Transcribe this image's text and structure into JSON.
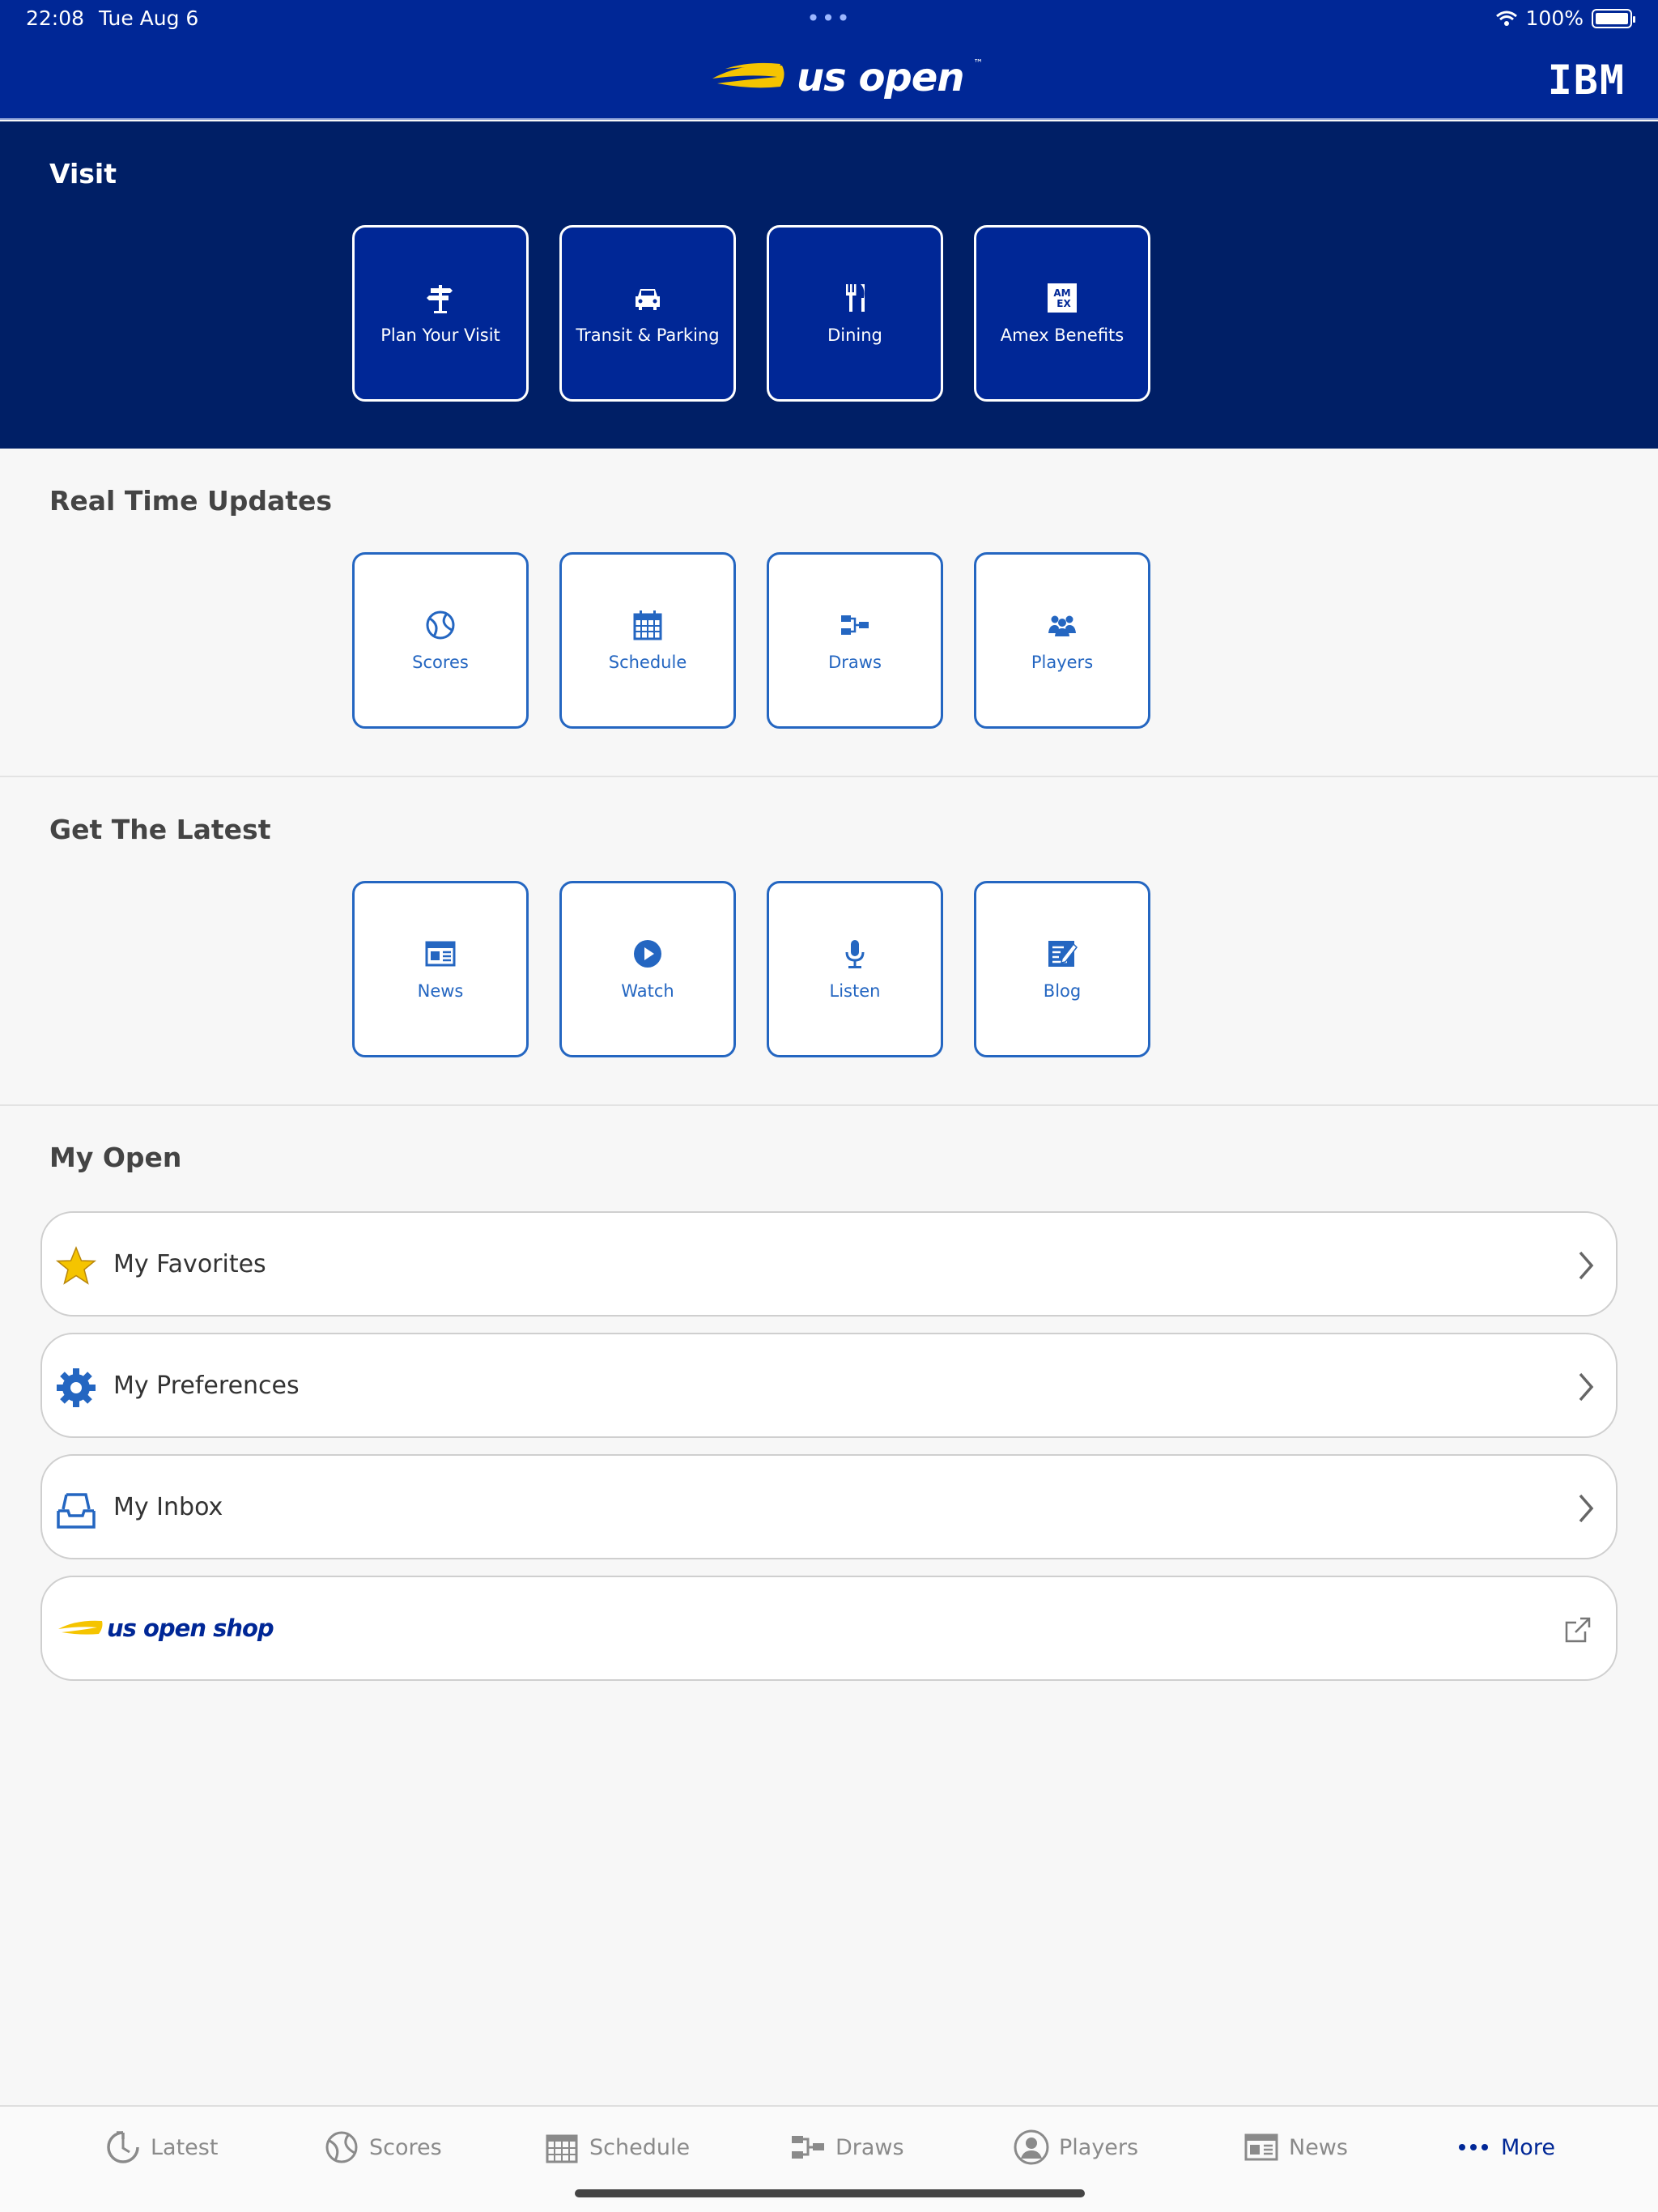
{
  "status_bar": {
    "time": "22:08",
    "date": "Tue Aug 6",
    "battery": "100%"
  },
  "header": {
    "logo_text": "us open",
    "sponsor": "IBM"
  },
  "visit": {
    "title": "Visit",
    "tiles": [
      {
        "label": "Plan Your Visit",
        "icon": "signpost-icon"
      },
      {
        "label": "Transit & Parking",
        "icon": "car-icon"
      },
      {
        "label": "Dining",
        "icon": "utensils-icon"
      },
      {
        "label": "Amex Benefits",
        "icon": "amex-icon"
      }
    ]
  },
  "real_time_updates": {
    "title": "Real Time Updates",
    "tiles": [
      {
        "label": "Scores",
        "icon": "tennis-ball-icon"
      },
      {
        "label": "Schedule",
        "icon": "calendar-icon"
      },
      {
        "label": "Draws",
        "icon": "bracket-icon"
      },
      {
        "label": "Players",
        "icon": "people-icon"
      }
    ]
  },
  "get_the_latest": {
    "title": "Get The Latest",
    "tiles": [
      {
        "label": "News",
        "icon": "newspaper-icon"
      },
      {
        "label": "Watch",
        "icon": "play-icon"
      },
      {
        "label": "Listen",
        "icon": "microphone-icon"
      },
      {
        "label": "Blog",
        "icon": "blog-icon"
      }
    ]
  },
  "my_open": {
    "title": "My Open",
    "rows": [
      {
        "label": "My Favorites",
        "icon": "star-icon"
      },
      {
        "label": "My Preferences",
        "icon": "gear-icon"
      },
      {
        "label": "My Inbox",
        "icon": "inbox-icon"
      }
    ],
    "shop": {
      "text": "us open shop",
      "icon": "external-link-icon"
    }
  },
  "tab_bar": {
    "tabs": [
      {
        "label": "Latest",
        "icon": "refresh-icon",
        "active": false
      },
      {
        "label": "Scores",
        "icon": "tennis-ball-icon",
        "active": false
      },
      {
        "label": "Schedule",
        "icon": "calendar-icon",
        "active": false
      },
      {
        "label": "Draws",
        "icon": "bracket-icon",
        "active": false
      },
      {
        "label": "Players",
        "icon": "person-icon",
        "active": false
      },
      {
        "label": "News",
        "icon": "newspaper-icon",
        "active": false
      },
      {
        "label": "More",
        "icon": "more-dots-icon",
        "active": true
      }
    ]
  },
  "colors": {
    "brand_navy": "#002796",
    "deep_navy": "#001f66",
    "accent_blue": "#2466c1",
    "yellow": "#f5c400"
  }
}
